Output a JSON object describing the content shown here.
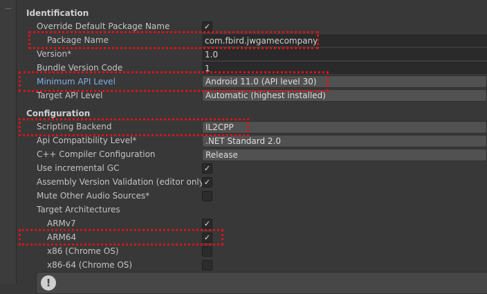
{
  "identification": {
    "header": "Identification",
    "override_default_package_name": {
      "label": "Override Default Package Name",
      "checked": true
    },
    "package_name": {
      "label": "Package Name",
      "value": "com.fbird.jwgamecompany"
    },
    "version": {
      "label": "Version*",
      "value": "1.0"
    },
    "bundle_version_code": {
      "label": "Bundle Version Code",
      "value": "1"
    },
    "minimum_api_level": {
      "label": "Minimum API Level",
      "value": "Android 11.0 (API level 30)"
    },
    "target_api_level": {
      "label": "Target API Level",
      "value": "Automatic (highest installed)"
    }
  },
  "configuration": {
    "header": "Configuration",
    "scripting_backend": {
      "label": "Scripting Backend",
      "value": "IL2CPP"
    },
    "api_compatibility_level": {
      "label": "Api Compatibility Level*",
      "value": ".NET Standard 2.0"
    },
    "cpp_compiler_configuration": {
      "label": "C++ Compiler Configuration",
      "value": "Release"
    },
    "use_incremental_gc": {
      "label": "Use incremental GC",
      "checked": true
    },
    "assembly_version_validation": {
      "label": "Assembly Version Validation (editor only)",
      "checked": true
    },
    "mute_other_audio_sources": {
      "label": "Mute Other Audio Sources*",
      "checked": false
    },
    "target_architectures": {
      "label": "Target Architectures",
      "armv7": {
        "label": "ARMv7",
        "checked": true
      },
      "arm64": {
        "label": "ARM64",
        "checked": true
      },
      "x86": {
        "label": "x86 (Chrome OS)",
        "checked": false
      },
      "x86_64": {
        "label": "x86-64 (Chrome OS)",
        "checked": false
      }
    }
  },
  "colors": {
    "background": "#383838",
    "highlight_outline": "#d9141a",
    "link_label": "#7fb0e6",
    "field_background": "#2a2a2a",
    "dropdown_background": "#515151"
  },
  "icons": {
    "checkmark": "check-icon",
    "warning": "warning-icon"
  }
}
